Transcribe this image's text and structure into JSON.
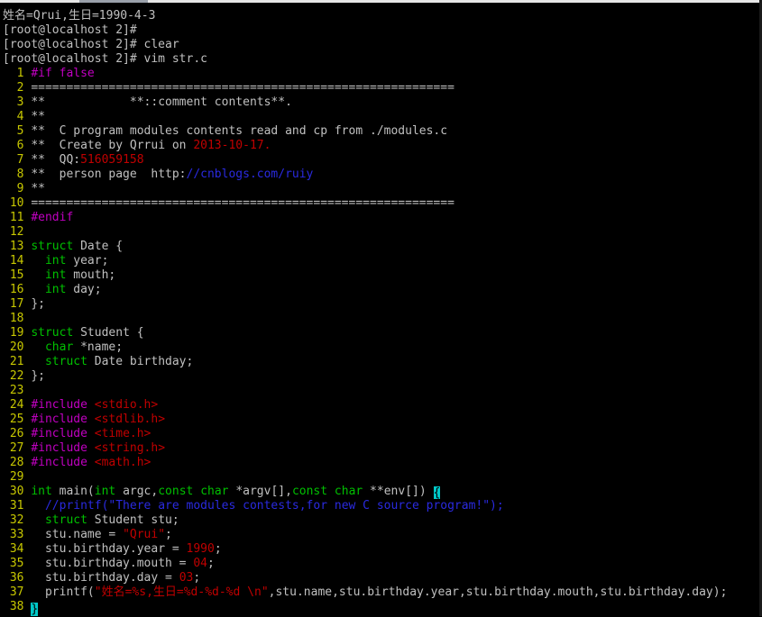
{
  "palette": {
    "background": "#000000",
    "default": "#c0c0c0",
    "line_number": "#c8c800",
    "preproc": "#c000c0",
    "type": "#00c000",
    "string": "#c00000",
    "comment": "#2a2ae0",
    "cursor": "#00c8c8"
  },
  "shell_lines": [
    "姓名=Qrui,生日=1990-4-3",
    "[root@localhost 2]#",
    "[root@localhost 2]# clear",
    "[root@localhost 2]# vim str.c"
  ],
  "vim_lines": [
    {
      "n": "1",
      "segs": [
        {
          "t": "#if false",
          "c": "preproc"
        }
      ]
    },
    {
      "n": "2",
      "segs": [
        {
          "t": "============================================================",
          "c": "default"
        }
      ]
    },
    {
      "n": "3",
      "segs": [
        {
          "t": "**            **::comment contents**.",
          "c": "default"
        }
      ]
    },
    {
      "n": "4",
      "segs": [
        {
          "t": "**",
          "c": "default"
        }
      ]
    },
    {
      "n": "5",
      "segs": [
        {
          "t": "**  C program modules contents read and cp from ./modules.c",
          "c": "default"
        }
      ]
    },
    {
      "n": "6",
      "segs": [
        {
          "t": "**  Create by Qrrui on ",
          "c": "default"
        },
        {
          "t": "2013-10-17.",
          "c": "string"
        }
      ]
    },
    {
      "n": "7",
      "segs": [
        {
          "t": "**  QQ:",
          "c": "default"
        },
        {
          "t": "516059158",
          "c": "string"
        }
      ]
    },
    {
      "n": "8",
      "segs": [
        {
          "t": "**  person page  http:",
          "c": "default"
        },
        {
          "t": "//cnblogs.com/ruiy",
          "c": "comment"
        }
      ]
    },
    {
      "n": "9",
      "segs": [
        {
          "t": "**",
          "c": "default"
        }
      ]
    },
    {
      "n": "10",
      "segs": [
        {
          "t": "============================================================",
          "c": "default"
        }
      ]
    },
    {
      "n": "11",
      "segs": [
        {
          "t": "#endif",
          "c": "preproc"
        }
      ]
    },
    {
      "n": "12",
      "segs": []
    },
    {
      "n": "13",
      "segs": [
        {
          "t": "struct",
          "c": "type"
        },
        {
          "t": " Date {",
          "c": "default"
        }
      ]
    },
    {
      "n": "14",
      "segs": [
        {
          "t": "  ",
          "c": "default"
        },
        {
          "t": "int",
          "c": "type"
        },
        {
          "t": " year;",
          "c": "default"
        }
      ]
    },
    {
      "n": "15",
      "segs": [
        {
          "t": "  ",
          "c": "default"
        },
        {
          "t": "int",
          "c": "type"
        },
        {
          "t": " mouth;",
          "c": "default"
        }
      ]
    },
    {
      "n": "16",
      "segs": [
        {
          "t": "  ",
          "c": "default"
        },
        {
          "t": "int",
          "c": "type"
        },
        {
          "t": " day;",
          "c": "default"
        }
      ]
    },
    {
      "n": "17",
      "segs": [
        {
          "t": "};",
          "c": "default"
        }
      ]
    },
    {
      "n": "18",
      "segs": []
    },
    {
      "n": "19",
      "segs": [
        {
          "t": "struct",
          "c": "type"
        },
        {
          "t": " Student {",
          "c": "default"
        }
      ]
    },
    {
      "n": "20",
      "segs": [
        {
          "t": "  ",
          "c": "default"
        },
        {
          "t": "char",
          "c": "type"
        },
        {
          "t": " *name;",
          "c": "default"
        }
      ]
    },
    {
      "n": "21",
      "segs": [
        {
          "t": "  ",
          "c": "default"
        },
        {
          "t": "struct",
          "c": "type"
        },
        {
          "t": " Date birthday;",
          "c": "default"
        }
      ]
    },
    {
      "n": "22",
      "segs": [
        {
          "t": "};",
          "c": "default"
        }
      ]
    },
    {
      "n": "23",
      "segs": []
    },
    {
      "n": "24",
      "segs": [
        {
          "t": "#include",
          "c": "preproc"
        },
        {
          "t": " ",
          "c": "default"
        },
        {
          "t": "<stdio.h>",
          "c": "string"
        }
      ]
    },
    {
      "n": "25",
      "segs": [
        {
          "t": "#include",
          "c": "preproc"
        },
        {
          "t": " ",
          "c": "default"
        },
        {
          "t": "<stdlib.h>",
          "c": "string"
        }
      ]
    },
    {
      "n": "26",
      "segs": [
        {
          "t": "#include",
          "c": "preproc"
        },
        {
          "t": " ",
          "c": "default"
        },
        {
          "t": "<time.h>",
          "c": "string"
        }
      ]
    },
    {
      "n": "27",
      "segs": [
        {
          "t": "#include",
          "c": "preproc"
        },
        {
          "t": " ",
          "c": "default"
        },
        {
          "t": "<string.h>",
          "c": "string"
        }
      ]
    },
    {
      "n": "28",
      "segs": [
        {
          "t": "#include",
          "c": "preproc"
        },
        {
          "t": " ",
          "c": "default"
        },
        {
          "t": "<math.h>",
          "c": "string"
        }
      ]
    },
    {
      "n": "29",
      "segs": []
    },
    {
      "n": "30",
      "segs": [
        {
          "t": "int",
          "c": "type"
        },
        {
          "t": " main(",
          "c": "default"
        },
        {
          "t": "int",
          "c": "type"
        },
        {
          "t": " argc,",
          "c": "default"
        },
        {
          "t": "const",
          "c": "type"
        },
        {
          "t": " ",
          "c": "default"
        },
        {
          "t": "char",
          "c": "type"
        },
        {
          "t": " *argv[],",
          "c": "default"
        },
        {
          "t": "const",
          "c": "type"
        },
        {
          "t": " ",
          "c": "default"
        },
        {
          "t": "char",
          "c": "type"
        },
        {
          "t": " **env[]) ",
          "c": "default"
        },
        {
          "t": "{",
          "c": "cursorbrace"
        }
      ]
    },
    {
      "n": "31",
      "segs": [
        {
          "t": "  ",
          "c": "default"
        },
        {
          "t": "//printf(\"There are modules contests,for new C source program!\");",
          "c": "comment"
        }
      ]
    },
    {
      "n": "32",
      "segs": [
        {
          "t": "  ",
          "c": "default"
        },
        {
          "t": "struct",
          "c": "type"
        },
        {
          "t": " Student stu;",
          "c": "default"
        }
      ]
    },
    {
      "n": "33",
      "segs": [
        {
          "t": "  stu.name = ",
          "c": "default"
        },
        {
          "t": "\"Qrui\"",
          "c": "string"
        },
        {
          "t": ";",
          "c": "default"
        }
      ]
    },
    {
      "n": "34",
      "segs": [
        {
          "t": "  stu.birthday.year = ",
          "c": "default"
        },
        {
          "t": "1990",
          "c": "string"
        },
        {
          "t": ";",
          "c": "default"
        }
      ]
    },
    {
      "n": "35",
      "segs": [
        {
          "t": "  stu.birthday.mouth = ",
          "c": "default"
        },
        {
          "t": "04",
          "c": "string"
        },
        {
          "t": ";",
          "c": "default"
        }
      ]
    },
    {
      "n": "36",
      "segs": [
        {
          "t": "  stu.birthday.day = ",
          "c": "default"
        },
        {
          "t": "03",
          "c": "string"
        },
        {
          "t": ";",
          "c": "default"
        }
      ]
    },
    {
      "n": "37",
      "segs": [
        {
          "t": "  printf(",
          "c": "default"
        },
        {
          "t": "\"姓名=%s,生日=%d-%d-%d \\n\"",
          "c": "string"
        },
        {
          "t": ",stu.name,stu.birthday.year,stu.birthday.mouth,stu.birthday.day);",
          "c": "default"
        }
      ]
    },
    {
      "n": "38",
      "segs": [
        {
          "t": "}",
          "c": "cursorblock"
        }
      ]
    }
  ]
}
